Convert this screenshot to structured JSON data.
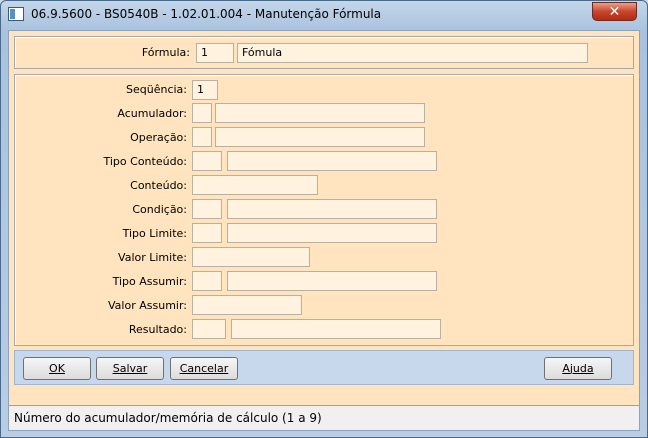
{
  "window": {
    "title": "06.9.5600 - BS0540B - 1.02.01.004 - Manutenção Fórmula",
    "close_label": "✕"
  },
  "header_panel": {
    "formula_label": "Fórmula:",
    "formula_code": "1",
    "formula_name": "Fómula"
  },
  "form": {
    "sequencia": {
      "label": "Seqüência:",
      "value": "1"
    },
    "acumulador": {
      "label": "Acumulador:",
      "code": "",
      "desc": ""
    },
    "operacao": {
      "label": "Operação:",
      "code": "",
      "desc": ""
    },
    "tipo_conteudo": {
      "label": "Tipo Conteúdo:",
      "code": "",
      "desc": ""
    },
    "conteudo": {
      "label": "Conteúdo:",
      "value": ""
    },
    "condicao": {
      "label": "Condição:",
      "code": "",
      "desc": ""
    },
    "tipo_limite": {
      "label": "Tipo Limite:",
      "code": "",
      "desc": ""
    },
    "valor_limite": {
      "label": "Valor Limite:",
      "value": ""
    },
    "tipo_assumir": {
      "label": "Tipo Assumir:",
      "code": "",
      "desc": ""
    },
    "valor_assumir": {
      "label": "Valor Assumir:",
      "value": ""
    },
    "resultado": {
      "label": "Resultado:",
      "code": "",
      "desc": ""
    }
  },
  "buttons": {
    "ok": {
      "mnemonic": "O",
      "rest": "K"
    },
    "salvar": {
      "mnemonic": "S",
      "rest": "alvar"
    },
    "cancelar": {
      "mnemonic": "C",
      "rest": "ancelar"
    },
    "ajuda": {
      "mnemonic": "A",
      "rest": "juda"
    }
  },
  "status": {
    "text": "Número do acumulador/memória de cálculo (1 a 9)"
  }
}
